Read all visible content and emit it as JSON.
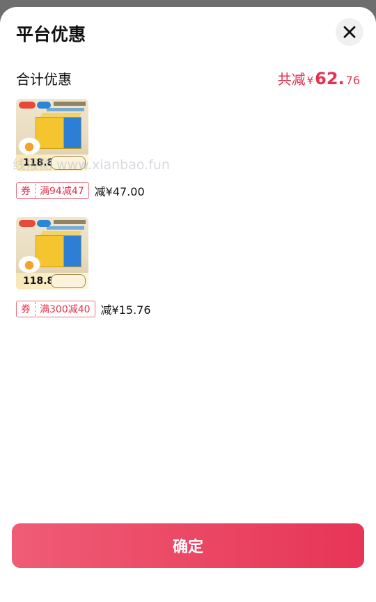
{
  "header": {
    "title": "平台优惠"
  },
  "summary": {
    "label": "合计优惠",
    "prefix": "共减",
    "currency": "¥",
    "amount_int": "62.",
    "amount_dec": "76"
  },
  "items": [
    {
      "thumb_price": "118.8",
      "coupon_tag": "券",
      "coupon_text": "满94减47",
      "discount": "减¥47.00"
    },
    {
      "thumb_price": "118.8",
      "coupon_tag": "券",
      "coupon_text": "满300减40",
      "discount": "减¥15.76"
    }
  ],
  "watermark": "线报酷 www.xianbao.fun",
  "confirm_label": "确定",
  "colors": {
    "accent": "#e5334f",
    "button_start": "#ef5c75",
    "button_end": "#e73556"
  }
}
